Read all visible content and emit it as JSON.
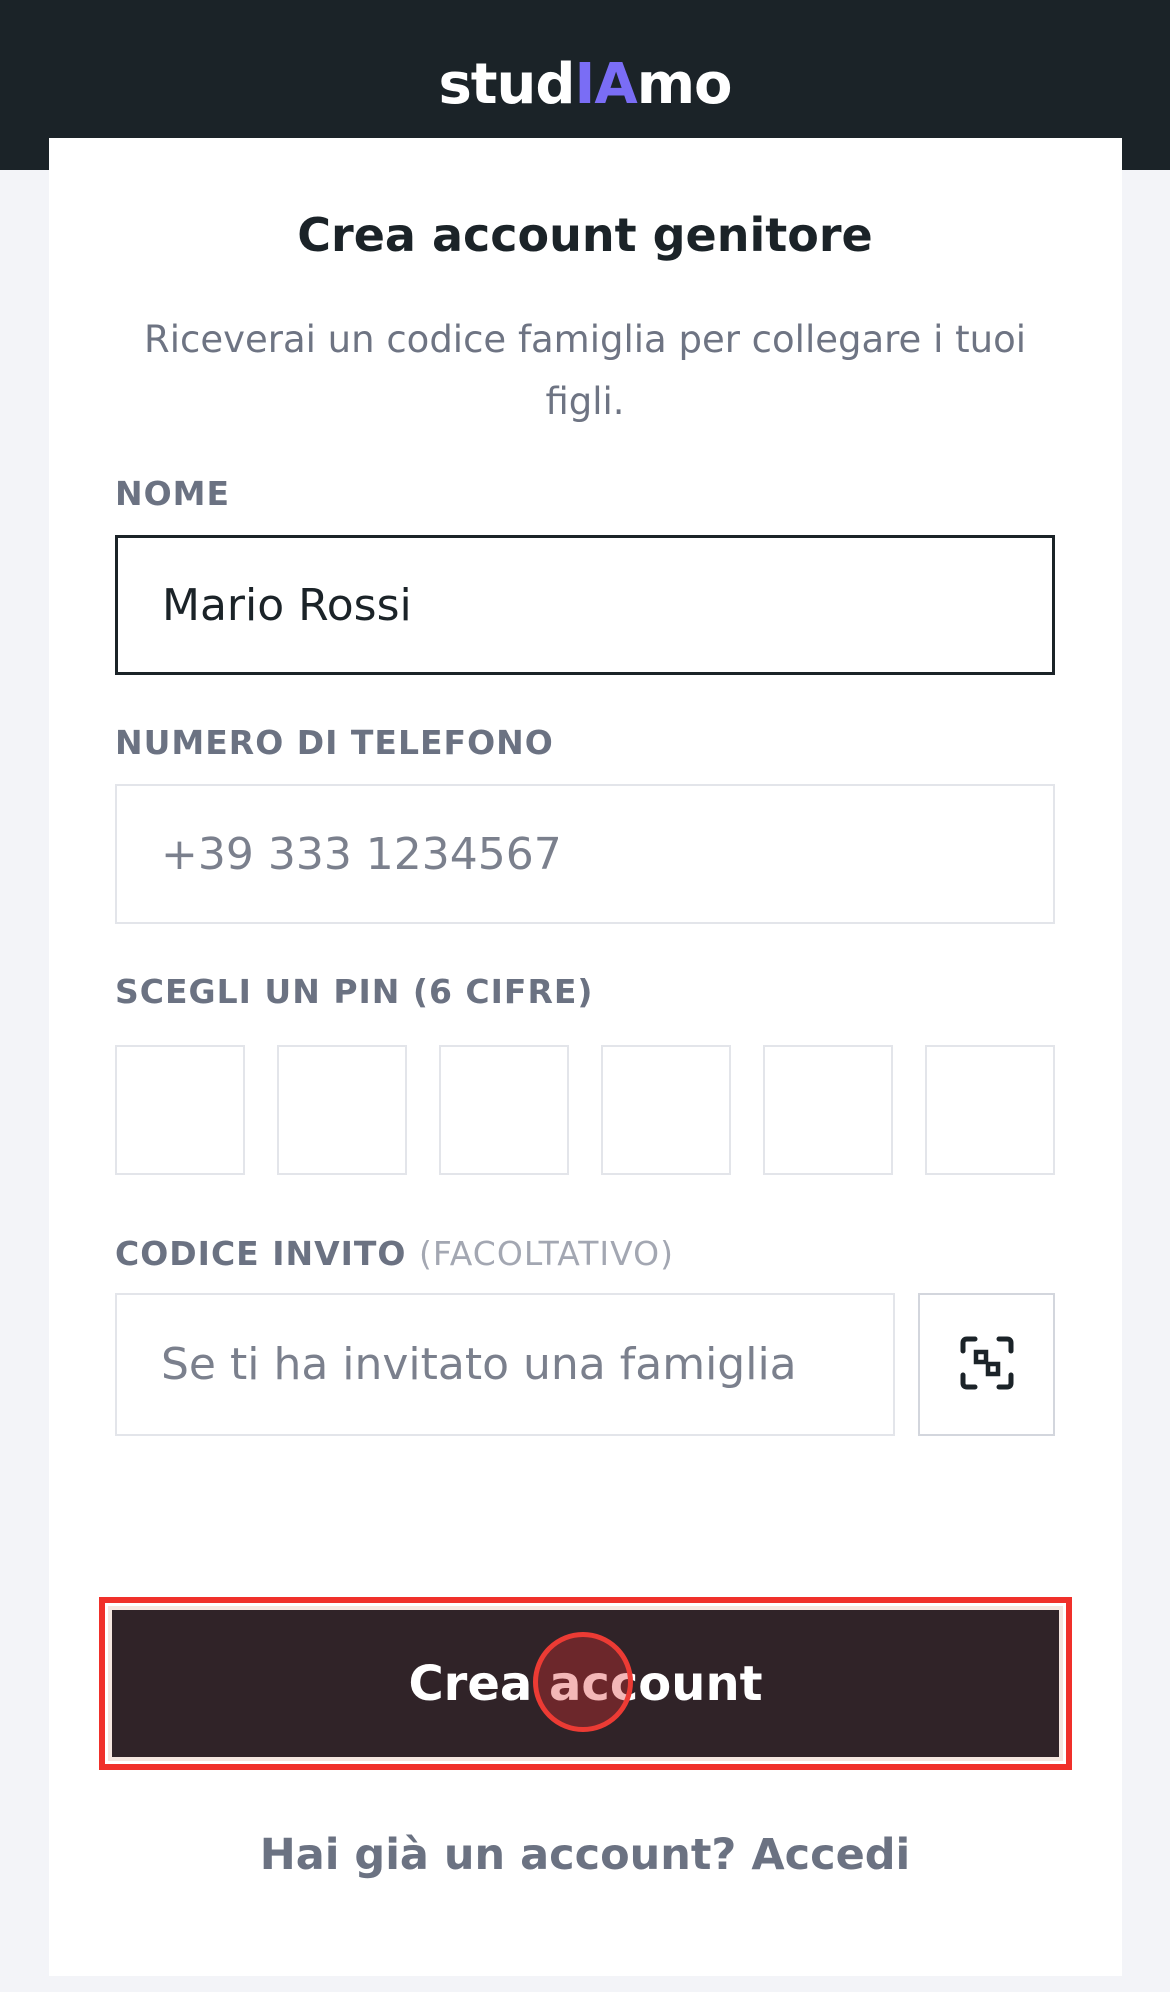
{
  "header": {
    "logo_part1": "stud",
    "logo_accent": "IA",
    "logo_part2": "mo",
    "accent_color": "#7a6df5",
    "background_color": "#1b2328"
  },
  "form": {
    "title": "Crea account genitore",
    "subtitle": "Riceverai un codice famiglia per collegare i tuoi figli.",
    "name_label": "NOME",
    "name_value": "Mario Rossi",
    "phone_label": "NUMERO DI TELEFONO",
    "phone_placeholder": "+39 333 1234567",
    "pin_label": "SCEGLI UN PIN (6 CIFRE)",
    "pin_digits": [
      "",
      "",
      "",
      "",
      "",
      ""
    ],
    "invite_label": "CODICE INVITO",
    "invite_optional": "(FACOLTATIVO)",
    "invite_placeholder": "Se ti ha invitato una famiglia",
    "scan_icon": "qr-scan-icon",
    "submit_label": "Crea account",
    "submit_color": "#302328",
    "login_link": "Hai già un account? Accedi"
  },
  "annotation": {
    "highlight_color": "#f0302a"
  }
}
